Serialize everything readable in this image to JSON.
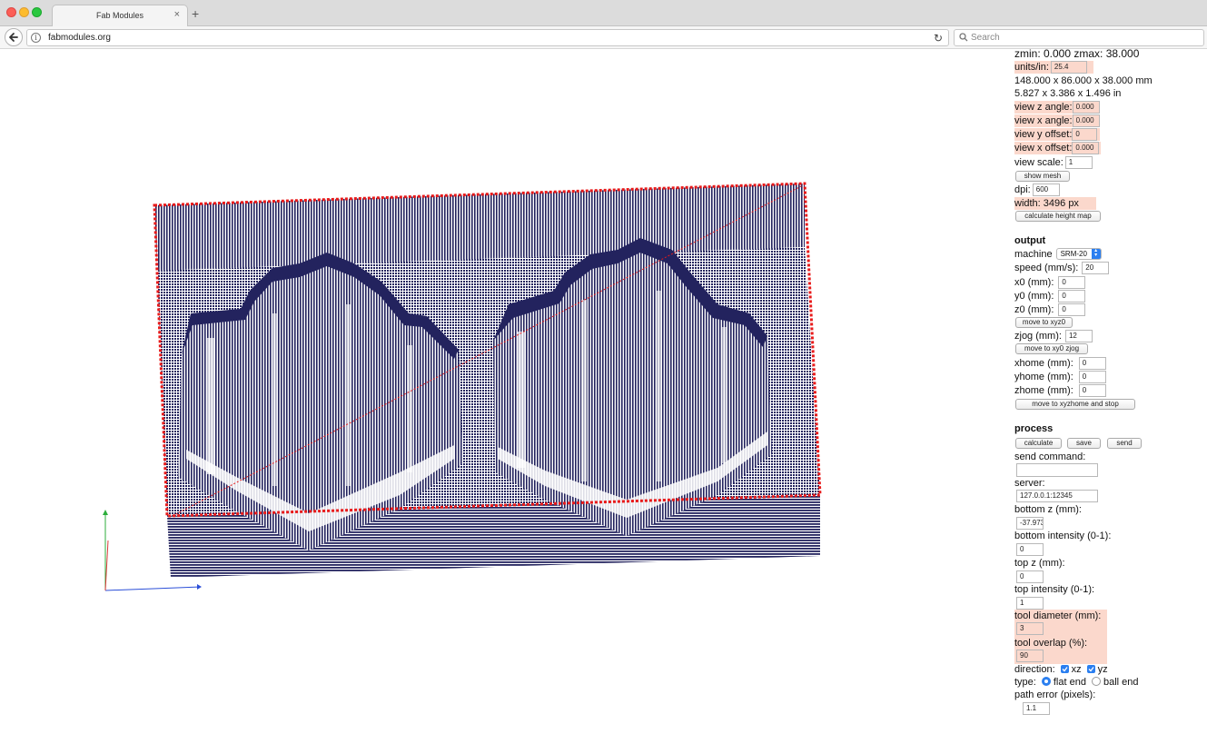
{
  "browser": {
    "tab_title": "Fab Modules",
    "tab_close": "×",
    "new_tab": "+",
    "url": "fabmodules.org",
    "search_placeholder": "Search"
  },
  "mesh_info": {
    "z_range": "zmin: 0.000 zmax: 38.000",
    "units_label": "units/in:",
    "units_value": "25.4",
    "size_mm": "148.000 x 86.000 x 38.000 mm",
    "size_in": "5.827 x 3.386 x 1.496 in",
    "view_z_angle_label": "view z angle:",
    "view_z_angle_value": "0.000",
    "view_x_angle_label": "view x angle:",
    "view_x_angle_value": "0.000",
    "view_y_offset_label": "view y offset:",
    "view_y_offset_value": "0",
    "view_x_offset_label": "view x offset:",
    "view_x_offset_value": "0.000",
    "view_scale_label": "view scale:",
    "view_scale_value": "1",
    "show_mesh_button": "show mesh",
    "dpi_label": "dpi:",
    "dpi_value": "600",
    "width_text": "width: 3496 px",
    "calc_height_map_button": "calculate height map"
  },
  "output": {
    "heading": "output",
    "machine_label": "machine",
    "machine_value": "SRM-20",
    "speed_label": "speed (mm/s):",
    "speed_value": "20",
    "x0_label": "x0 (mm):",
    "x0_value": "0",
    "y0_label": "y0 (mm):",
    "y0_value": "0",
    "z0_label": "z0 (mm):",
    "z0_value": "0",
    "move_xyz0_button": "move to xyz0",
    "zjog_label": "zjog (mm):",
    "zjog_value": "12",
    "move_xy0_zjog_button": "move to xy0 zjog",
    "xhome_label": "xhome (mm):",
    "xhome_value": "0",
    "yhome_label": "yhome (mm):",
    "yhome_value": "0",
    "zhome_label": "zhome (mm):",
    "zhome_value": "0",
    "move_home_button": "move to xyzhome and stop"
  },
  "process": {
    "heading": "process",
    "calculate_button": "calculate",
    "save_button": "save",
    "send_button": "send",
    "send_command_label": "send command:",
    "send_command_value": "",
    "server_label": "server:",
    "server_value": "127.0.0.1:12345",
    "bottom_z_label": "bottom z (mm):",
    "bottom_z_value": "-37.973",
    "bottom_intensity_label": "bottom intensity (0-1):",
    "bottom_intensity_value": "0",
    "top_z_label": "top z (mm):",
    "top_z_value": "0",
    "top_intensity_label": "top intensity (0-1):",
    "top_intensity_value": "1",
    "tool_diameter_label": "tool diameter (mm):",
    "tool_diameter_value": "3",
    "tool_overlap_label": "tool overlap (%):",
    "tool_overlap_value": "90",
    "direction_label": "direction:",
    "direction_xz": "xz",
    "direction_yz": "yz",
    "type_label": "type:",
    "type_flat": "flat end",
    "type_ball": "ball end",
    "path_error_label": "path error (pixels):",
    "path_error_value": "1.1"
  },
  "colors": {
    "mesh": "#23235e",
    "outline": "#e81a1a",
    "highlight": "#fbd8cc",
    "accent": "#2b7ff0"
  }
}
